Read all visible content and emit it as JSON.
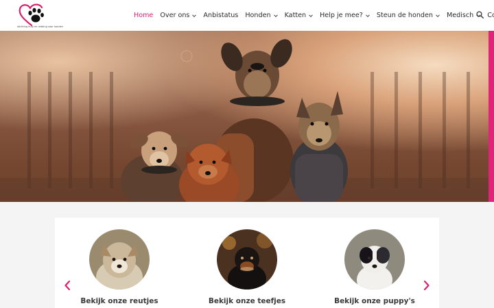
{
  "logo": {
    "tagline": "stichting hulp en redding voor honden",
    "icon": "heart-paw-logo"
  },
  "nav": {
    "items": [
      {
        "label": "Home",
        "active": true,
        "dropdown": false
      },
      {
        "label": "Over ons",
        "dropdown": true
      },
      {
        "label": "Anbistatus",
        "dropdown": false
      },
      {
        "label": "Honden",
        "dropdown": true
      },
      {
        "label": "Katten",
        "dropdown": true
      },
      {
        "label": "Help je mee?",
        "dropdown": true
      },
      {
        "label": "Steun de honden",
        "dropdown": true
      },
      {
        "label": "Medisch",
        "dropdown": true
      },
      {
        "label": "Contact",
        "dropdown": false
      }
    ],
    "search_icon": "search-icon"
  },
  "colors": {
    "accent": "#d6216f",
    "hero_bar": "#e3237b"
  },
  "cards": [
    {
      "title": "Bekijk onze reutjes"
    },
    {
      "title": "Bekijk onze teefjes"
    },
    {
      "title": "Bekijk onze puppy's"
    }
  ],
  "carousel": {
    "prev_icon": "chevron-left-icon",
    "next_icon": "chevron-right-icon"
  }
}
